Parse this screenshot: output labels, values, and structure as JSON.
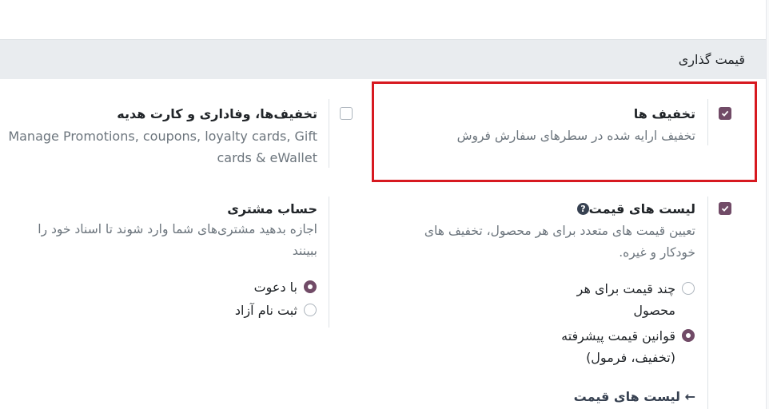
{
  "section": {
    "title": "قیمت گذاری"
  },
  "discounts": {
    "checked": true,
    "title": "تخفیف ها",
    "description": "تخفیف ارایه شده در سطرهای سفارش فروش"
  },
  "loyalty": {
    "checked": false,
    "title": "تخفیف‌ها، وفاداری و کارت هدیه",
    "description_line1": "Manage Promotions, coupons, loyalty cards, Gift",
    "description_line2": "cards & eWallet"
  },
  "pricelists": {
    "checked": true,
    "title": "لیست های قیمت",
    "help_icon": "?",
    "description_line1": "تعیین قیمت های متعدد برای هر محصول، تخفیف های",
    "description_line2": "خودکار و غیره.",
    "options": [
      {
        "label_line1": "چند قیمت برای هر",
        "label_line2": "محصول",
        "selected": false
      },
      {
        "label_line1": "قوانین قیمت پیشرفته",
        "label_line2": "(تخفیف، فرمول)",
        "selected": true
      }
    ],
    "link_label": "لیست های قیمت",
    "link_arrow": "←"
  },
  "customer_account": {
    "title": "حساب مشتری",
    "description_line1": "اجازه بدهید مشتری‌های شما وارد شوند تا اسناد خود را",
    "description_line2": "ببینند",
    "options": [
      {
        "label": "با دعوت",
        "selected": true
      },
      {
        "label": "ثبت نام آزاد",
        "selected": false
      }
    ]
  },
  "colors": {
    "accent": "#714b67",
    "highlight": "#d71920",
    "header_bg": "#e9ecef"
  }
}
